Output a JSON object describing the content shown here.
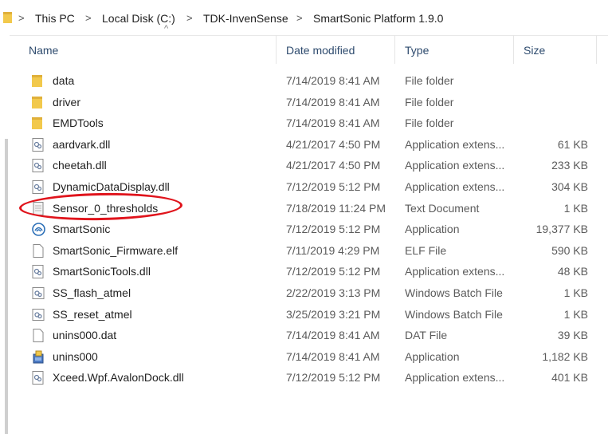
{
  "breadcrumb": {
    "items": [
      "This PC",
      "Local Disk (C:)",
      "TDK-InvenSense",
      "SmartSonic Platform 1.9.0"
    ]
  },
  "columns": {
    "name": "Name",
    "date": "Date modified",
    "type": "Type",
    "size": "Size"
  },
  "files": [
    {
      "name": "data",
      "date": "7/14/2019 8:41 AM",
      "type": "File folder",
      "size": "",
      "icon": "folder-icon"
    },
    {
      "name": "driver",
      "date": "7/14/2019 8:41 AM",
      "type": "File folder",
      "size": "",
      "icon": "folder-icon"
    },
    {
      "name": "EMDTools",
      "date": "7/14/2019 8:41 AM",
      "type": "File folder",
      "size": "",
      "icon": "folder-icon"
    },
    {
      "name": "aardvark.dll",
      "date": "4/21/2017 4:50 PM",
      "type": "Application extens...",
      "size": "61 KB",
      "icon": "dll-file-icon"
    },
    {
      "name": "cheetah.dll",
      "date": "4/21/2017 4:50 PM",
      "type": "Application extens...",
      "size": "233 KB",
      "icon": "dll-file-icon"
    },
    {
      "name": "DynamicDataDisplay.dll",
      "date": "7/12/2019 5:12 PM",
      "type": "Application extens...",
      "size": "304 KB",
      "icon": "dll-file-icon"
    },
    {
      "name": "Sensor_0_thresholds",
      "date": "7/18/2019 11:24 PM",
      "type": "Text Document",
      "size": "1 KB",
      "icon": "text-document-icon"
    },
    {
      "name": "SmartSonic",
      "date": "7/12/2019 5:12 PM",
      "type": "Application",
      "size": "19,377 KB",
      "icon": "smartsonic-app-icon"
    },
    {
      "name": "SmartSonic_Firmware.elf",
      "date": "7/11/2019 4:29 PM",
      "type": "ELF File",
      "size": "590 KB",
      "icon": "blank-file-icon"
    },
    {
      "name": "SmartSonicTools.dll",
      "date": "7/12/2019 5:12 PM",
      "type": "Application extens...",
      "size": "48 KB",
      "icon": "dll-file-icon"
    },
    {
      "name": "SS_flash_atmel",
      "date": "2/22/2019 3:13 PM",
      "type": "Windows Batch File",
      "size": "1 KB",
      "icon": "batch-file-icon"
    },
    {
      "name": "SS_reset_atmel",
      "date": "3/25/2019 3:21 PM",
      "type": "Windows Batch File",
      "size": "1 KB",
      "icon": "batch-file-icon"
    },
    {
      "name": "unins000.dat",
      "date": "7/14/2019 8:41 AM",
      "type": "DAT File",
      "size": "39 KB",
      "icon": "blank-file-icon"
    },
    {
      "name": "unins000",
      "date": "7/14/2019 8:41 AM",
      "type": "Application",
      "size": "1,182 KB",
      "icon": "installer-app-icon"
    },
    {
      "name": "Xceed.Wpf.AvalonDock.dll",
      "date": "7/12/2019 5:12 PM",
      "type": "Application extens...",
      "size": "401 KB",
      "icon": "dll-file-icon"
    }
  ],
  "annotation": {
    "color": "#e0141c",
    "target": "Sensor_0_thresholds"
  },
  "colors": {
    "folder": "#f2c94c",
    "header_text": "#2e4b6e"
  }
}
